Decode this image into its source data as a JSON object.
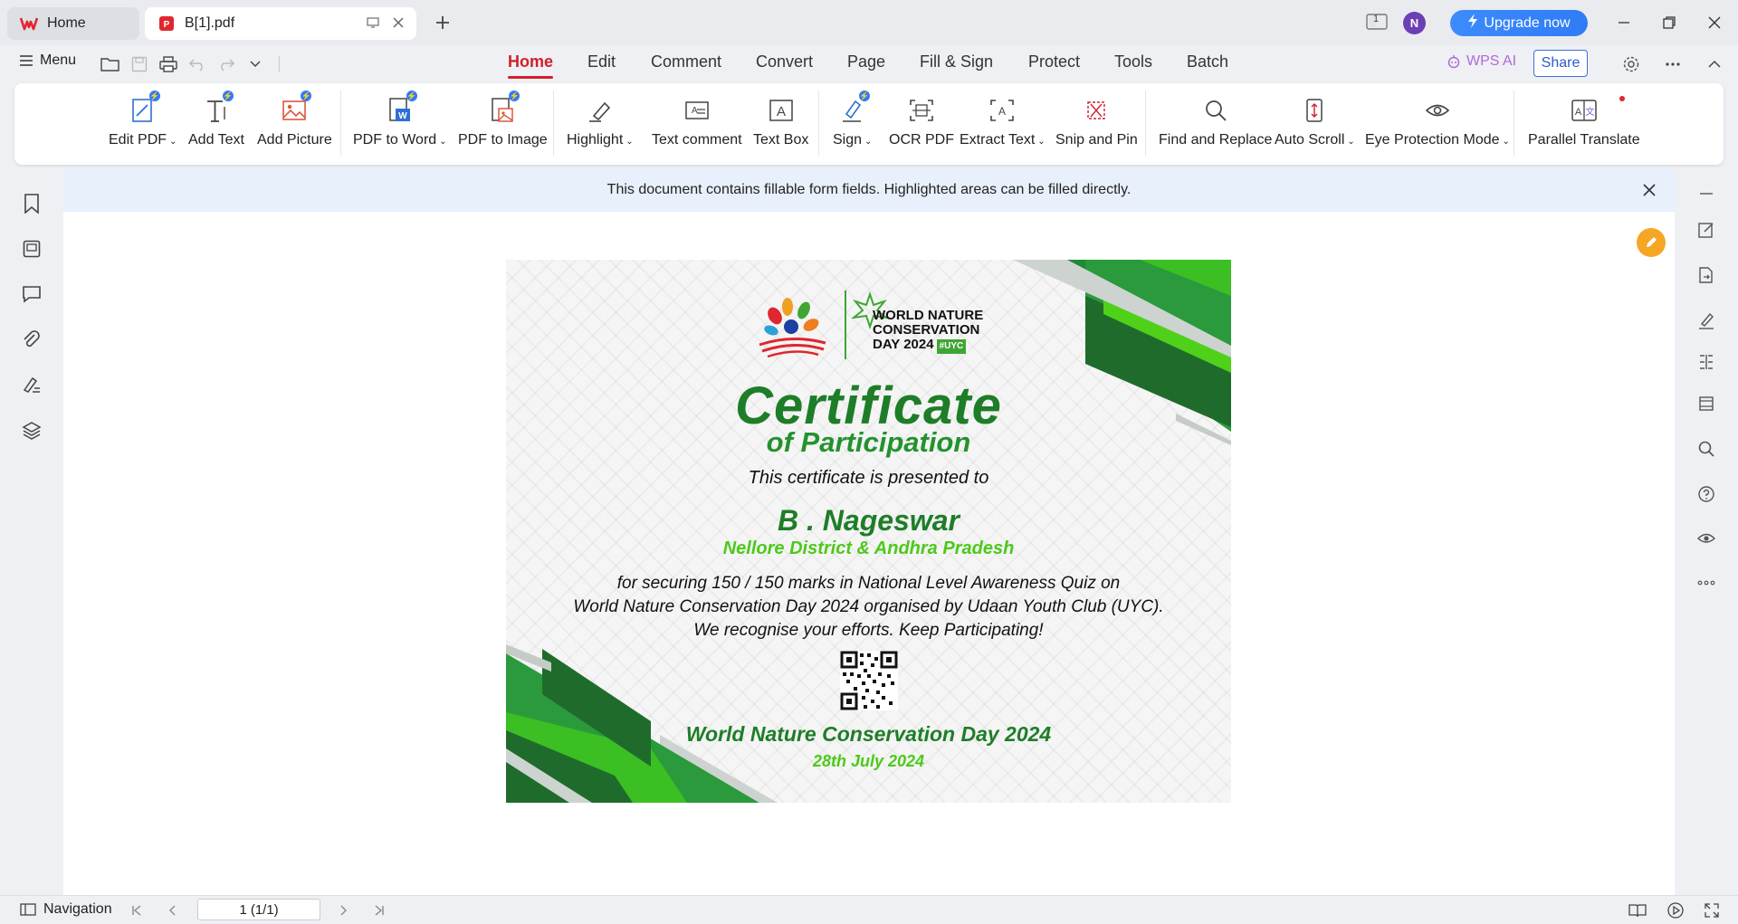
{
  "titlebar": {
    "home_tab": "Home",
    "doc_tab": "B[1].pdf",
    "upgrade": "Upgrade now",
    "avatar": "N",
    "page_indicator": "1"
  },
  "menu": {
    "menu_label": "Menu",
    "tabs": [
      "Home",
      "Edit",
      "Comment",
      "Convert",
      "Page",
      "Fill & Sign",
      "Protect",
      "Tools",
      "Batch"
    ],
    "wps_ai": "WPS AI",
    "share": "Share"
  },
  "ribbon": {
    "tools": [
      "Edit PDF",
      "Add Text",
      "Add Picture",
      "PDF to Word",
      "PDF to Image",
      "Highlight",
      "Text comment",
      "Text Box",
      "Sign",
      "OCR PDF",
      "Extract Text",
      "Snip and Pin",
      "Find and Replace",
      "Auto Scroll",
      "Eye Protection Mode",
      "Parallel Translate"
    ]
  },
  "notice": {
    "text": "This document contains fillable form fields. Highlighted areas can be filled directly."
  },
  "certificate": {
    "logo_text": [
      "WORLD NATURE",
      "CONSERVATION",
      "DAY 2024"
    ],
    "logo_tag": "#UYC",
    "title": "Certificate",
    "subtitle": "of Participation",
    "presented": "This certificate is presented to",
    "name": "B . Nageswar",
    "place": "Nellore District & Andhra Pradesh",
    "body_lines": [
      "for securing 150 / 150 marks in National Level Awareness Quiz on",
      "World Nature Conservation Day 2024 organised by Udaan Youth Club (UYC).",
      "We recognise your efforts. Keep Participating!"
    ],
    "event": "World Nature Conservation Day 2024",
    "date": "28th July 2024"
  },
  "status": {
    "navigation": "Navigation",
    "page": "1 (1/1)"
  },
  "colors": {
    "accent_red": "#d0202c",
    "upgrade_blue": "#2f7cf6",
    "cert_green": "#1e7d28",
    "cert_lime": "#4dc91a"
  }
}
